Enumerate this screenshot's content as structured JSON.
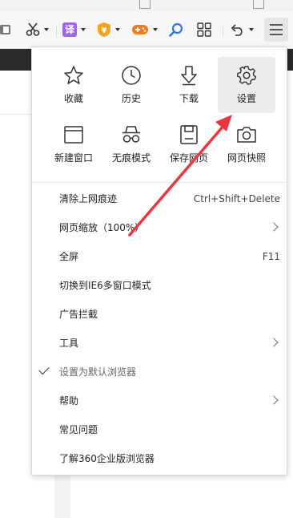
{
  "toolbar": {
    "translate_label": "译",
    "icons": [
      "book-icon",
      "scissors-icon",
      "translate-icon",
      "coupon-icon",
      "game-icon",
      "search-icon",
      "grid-icon",
      "undo-icon",
      "menu-icon"
    ]
  },
  "menu": {
    "grid": [
      {
        "id": "favorites",
        "label": "收藏",
        "icon": "star-icon"
      },
      {
        "id": "history",
        "label": "历史",
        "icon": "clock-icon"
      },
      {
        "id": "downloads",
        "label": "下载",
        "icon": "download-icon"
      },
      {
        "id": "settings",
        "label": "设置",
        "icon": "gear-icon"
      },
      {
        "id": "new-window",
        "label": "新建窗口",
        "icon": "window-icon"
      },
      {
        "id": "incognito",
        "label": "无痕模式",
        "icon": "incognito-icon"
      },
      {
        "id": "save-page",
        "label": "保存网页",
        "icon": "save-icon"
      },
      {
        "id": "snapshot",
        "label": "网页快照",
        "icon": "camera-icon"
      }
    ],
    "items": [
      {
        "label": "清除上网痕迹",
        "shortcut": "Ctrl+Shift+Delete"
      },
      {
        "label": "网页缩放（100%）",
        "submenu": true
      },
      {
        "label": "全屏",
        "shortcut": "F11"
      },
      {
        "label": "切换到IE6多窗口模式"
      },
      {
        "label": "广告拦截"
      },
      {
        "label": "工具",
        "submenu": true
      },
      {
        "label": "设置为默认浏览器",
        "checked": true
      },
      {
        "label": "帮助",
        "submenu": true
      },
      {
        "label": "常见问题"
      },
      {
        "label": "了解360企业版浏览器"
      }
    ]
  },
  "colors": {
    "accent_red": "#e8383d",
    "translate_purple": "#a066e8",
    "coupon_orange": "#f5a31a",
    "game_orange": "#f27b1f",
    "search_blue": "#2a7ae2"
  }
}
